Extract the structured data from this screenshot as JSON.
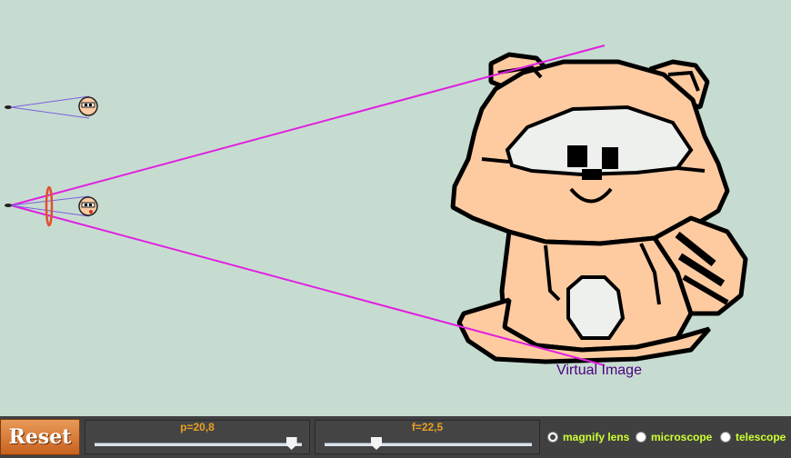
{
  "scene": {
    "virtual_image_label": "Virtual Image"
  },
  "controls": {
    "reset_label": "Reset",
    "p_label": "p=20,8",
    "p_fraction": 0.95,
    "f_label": "f=22,5",
    "f_fraction": 0.25,
    "modes": [
      {
        "label": "magnify lens",
        "selected": true
      },
      {
        "label": "microscope",
        "selected": false
      },
      {
        "label": "telescope",
        "selected": false
      }
    ]
  },
  "colors": {
    "ray": "#e020e0",
    "ray_small": "#7a60e0",
    "lens": "#e05030",
    "tanuki_body": "#fecba1",
    "tanuki_outline": "#000000",
    "background": "#c7dcd0",
    "slider_label": "#e8a020",
    "radio_label": "#ccff33"
  }
}
